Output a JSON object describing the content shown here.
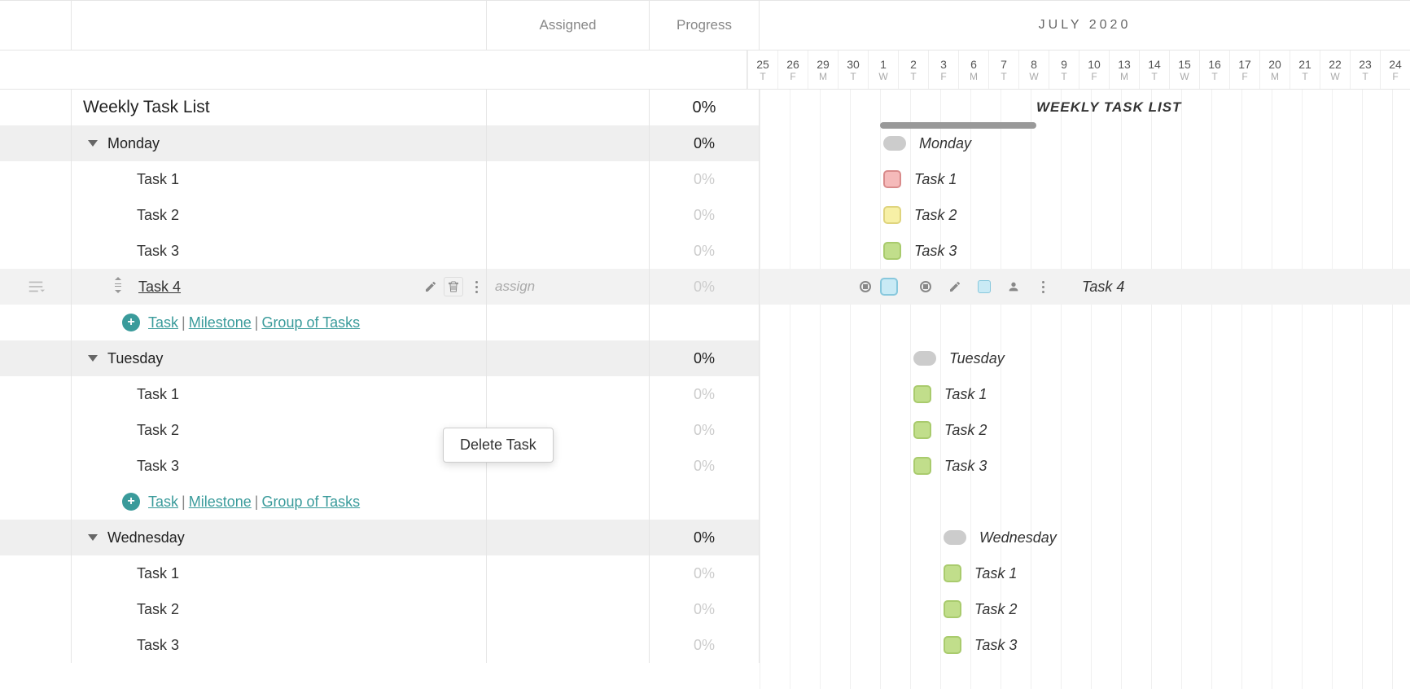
{
  "header": {
    "assigned": "Assigned",
    "progress": "Progress",
    "month": "JULY 2020"
  },
  "dates": [
    {
      "d": "25",
      "w": "T"
    },
    {
      "d": "26",
      "w": "F"
    },
    {
      "d": "29",
      "w": "M"
    },
    {
      "d": "30",
      "w": "T"
    },
    {
      "d": "1",
      "w": "W"
    },
    {
      "d": "2",
      "w": "T"
    },
    {
      "d": "3",
      "w": "F"
    },
    {
      "d": "6",
      "w": "M"
    },
    {
      "d": "7",
      "w": "T"
    },
    {
      "d": "8",
      "w": "W"
    },
    {
      "d": "9",
      "w": "T"
    },
    {
      "d": "10",
      "w": "F"
    },
    {
      "d": "13",
      "w": "M"
    },
    {
      "d": "14",
      "w": "T"
    },
    {
      "d": "15",
      "w": "W"
    },
    {
      "d": "16",
      "w": "T"
    },
    {
      "d": "17",
      "w": "F"
    },
    {
      "d": "20",
      "w": "M"
    },
    {
      "d": "21",
      "w": "T"
    },
    {
      "d": "22",
      "w": "W"
    },
    {
      "d": "23",
      "w": "T"
    },
    {
      "d": "24",
      "w": "F"
    }
  ],
  "title": {
    "name": "Weekly Task List",
    "progress": "0%",
    "tl_name": "WEEKLY TASK LIST"
  },
  "groups": {
    "mon": {
      "name": "Monday",
      "progress": "0%",
      "tasks": [
        {
          "name": "Task 1",
          "progress": "0%"
        },
        {
          "name": "Task 2",
          "progress": "0%"
        },
        {
          "name": "Task 3",
          "progress": "0%"
        },
        {
          "name": "Task 4",
          "progress": "0%",
          "assigned_placeholder": "assign"
        }
      ]
    },
    "tue": {
      "name": "Tuesday",
      "progress": "0%",
      "tasks": [
        {
          "name": "Task 1",
          "progress": "0%"
        },
        {
          "name": "Task 2",
          "progress": "0%"
        },
        {
          "name": "Task 3",
          "progress": "0%"
        }
      ]
    },
    "wed": {
      "name": "Wednesday",
      "progress": "0%",
      "tasks": [
        {
          "name": "Task 1",
          "progress": "0%"
        },
        {
          "name": "Task 2",
          "progress": "0%"
        },
        {
          "name": "Task 3",
          "progress": "0%"
        }
      ]
    }
  },
  "add": {
    "task": "Task",
    "milestone": "Milestone",
    "group": "Group of Tasks"
  },
  "ctx": {
    "delete": "Delete Task"
  },
  "tl_sel_label": "Task 4"
}
